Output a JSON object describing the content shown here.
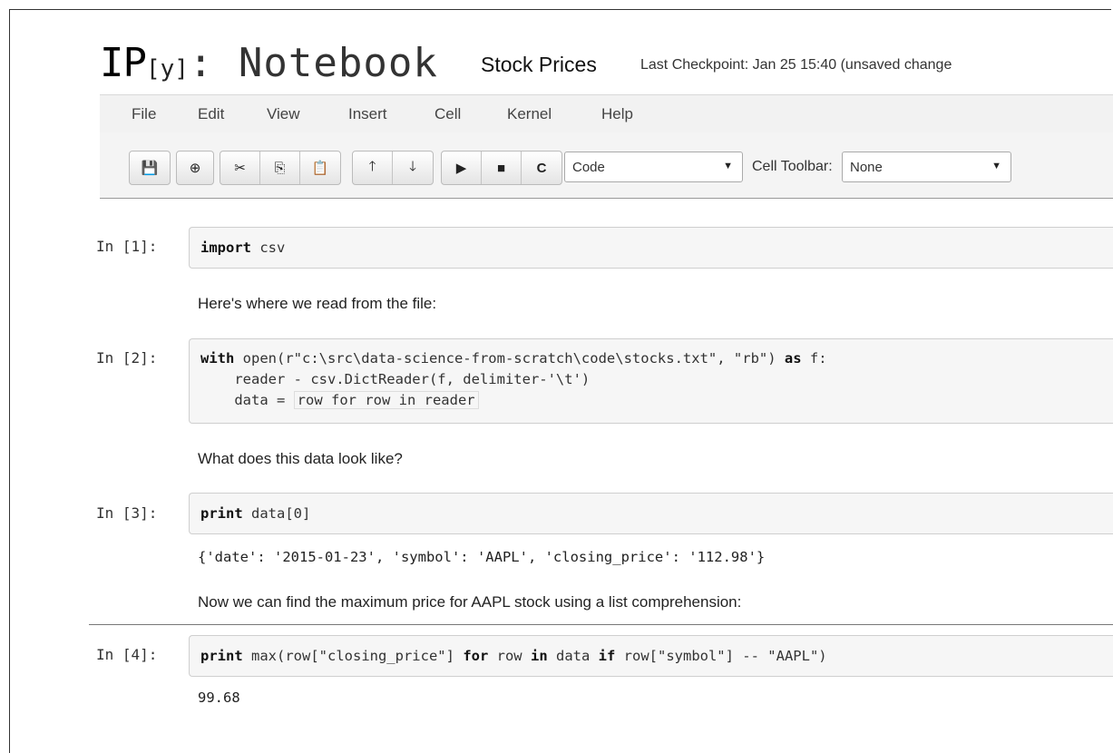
{
  "header": {
    "logo_ip": "IP",
    "logo_y": "[y]",
    "logo_rest": ": Notebook",
    "notebook_name": "Stock Prices",
    "checkpoint": "Last Checkpoint: Jan 25 15:40 (unsaved change"
  },
  "menu": [
    "File",
    "Edit",
    "View",
    "Insert",
    "Cell",
    "Kernel",
    "Help"
  ],
  "toolbar": {
    "icons": {
      "save": "💾",
      "insert_below": "⊕",
      "cut": "✂",
      "copy": "⎘",
      "paste": "📋",
      "move_up": "🡑",
      "move_down": "🡓",
      "run": "▶",
      "stop": "■",
      "restart": "C"
    },
    "cell_type": "Code",
    "cell_toolbar_label": "Cell Toolbar:",
    "cell_toolbar_value": "None"
  },
  "cells": {
    "c1": {
      "prompt": "In [1]:",
      "kw": "import",
      "rest": " csv"
    },
    "md1": "Here's where we read from the file:",
    "c2": {
      "prompt": "In [2]:",
      "l1_kw1": "with",
      "l1_mid": " open(r\"c:\\src\\data-science-from-scratch\\code\\stocks.txt\", \"rb\") ",
      "l1_kw2": "as",
      "l1_end": " f:",
      "l2": "    reader - csv.DictReader(f, delimiter-'\\t')",
      "l3_pre": "    data = ",
      "l3_bracket": "row for row in reader"
    },
    "md2": "What does this data look like?",
    "c3": {
      "prompt": "In [3]:",
      "kw": "print",
      "rest": " data[0]"
    },
    "out3": "{'date': '2015-01-23', 'symbol': 'AAPL', 'closing_price': '112.98'}",
    "md3": "Now we can find the maximum price for AAPL stock using a list comprehension:",
    "c4": {
      "prompt": "In [4]:",
      "kw1": "print",
      "mid1": " max(row[\"closing_price\"] ",
      "kw2": "for",
      "mid2": " row ",
      "kw3": "in",
      "mid3": " data ",
      "kw4": "if",
      "end": " row[\"symbol\"] -- \"AAPL\")"
    },
    "out4": "99.68"
  }
}
